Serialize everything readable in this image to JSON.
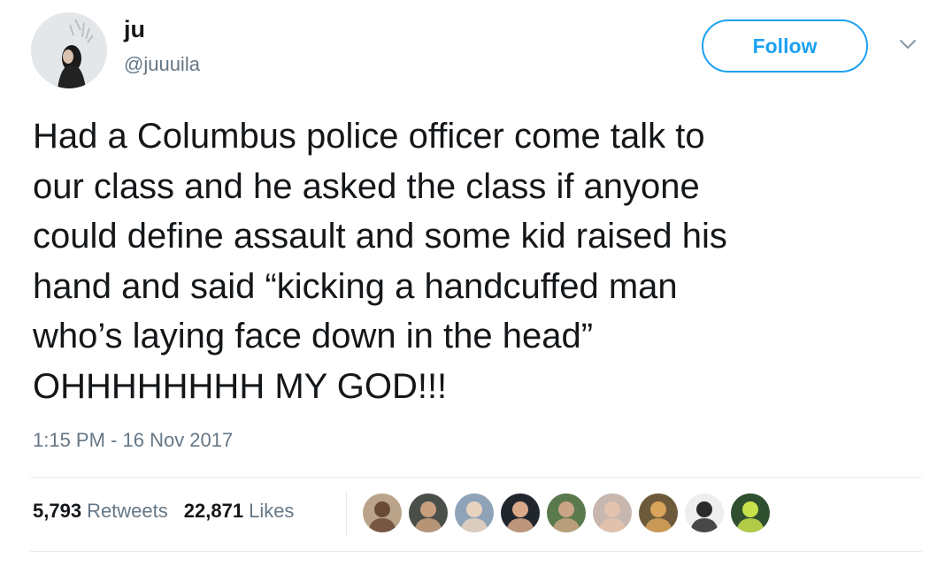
{
  "user": {
    "name": "ju",
    "handle": "@juuuila",
    "avatar_icon": "profile-photo"
  },
  "follow_button": {
    "label": "Follow",
    "color": "#1da1f2"
  },
  "menu_icon": "chevron-down-icon",
  "tweet": {
    "text": "Had a Columbus police officer come talk to\nour class and he asked the class if anyone\ncould define assault and some kid raised his\nhand and said “kicking a handcuffed man\nwho’s laying face down in the head”\nOHHHHHHHH MY GOD!!!",
    "timestamp": "1:15 PM - 16 Nov 2017"
  },
  "stats": {
    "retweets": {
      "count": "5,793",
      "label": "Retweets"
    },
    "likes": {
      "count": "22,871",
      "label": "Likes"
    }
  },
  "likers": [
    {
      "bg": "#b9a48a",
      "skin": "#6b4a35"
    },
    {
      "bg": "#4a4f4a",
      "skin": "#c9a07e"
    },
    {
      "bg": "#8ea3b8",
      "skin": "#e8d3c0"
    },
    {
      "bg": "#20262c",
      "skin": "#d9a98a"
    },
    {
      "bg": "#5a7a4e",
      "skin": "#caa484"
    },
    {
      "bg": "#c7b7ae",
      "skin": "#e3c3ad"
    },
    {
      "bg": "#6c5a3a",
      "skin": "#d8a35a"
    },
    {
      "bg": "#eeeeee",
      "skin": "#2a2a2a"
    },
    {
      "bg": "#2f4f2f",
      "skin": "#c8e04a"
    }
  ]
}
